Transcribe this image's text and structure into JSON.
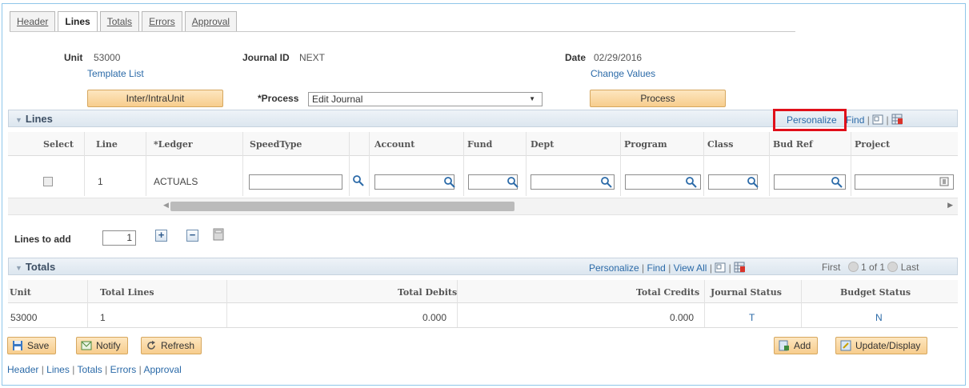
{
  "tabs": [
    {
      "label": "Header",
      "active": false
    },
    {
      "label": "Lines",
      "active": true
    },
    {
      "label": "Totals",
      "active": false
    },
    {
      "label": "Errors",
      "active": false
    },
    {
      "label": "Approval",
      "active": false
    }
  ],
  "header": {
    "unit_label": "Unit",
    "unit_value": "53000",
    "journal_label": "Journal ID",
    "journal_value": "NEXT",
    "date_label": "Date",
    "date_value": "02/29/2016",
    "template_link": "Template List",
    "change_values_link": "Change Values",
    "inter_button": "Inter/IntraUnit",
    "process_label": "*Process",
    "process_value": "Edit Journal",
    "process_button": "Process"
  },
  "lines": {
    "title": "Lines",
    "personalize": "Personalize",
    "find": "Find",
    "columns": [
      "Select",
      "Line",
      "*Ledger",
      "SpeedType",
      "Account",
      "Fund",
      "Dept",
      "Program",
      "Class",
      "Bud Ref",
      "Project"
    ],
    "row": {
      "line": "1",
      "ledger": "ACTUALS"
    },
    "lines_to_add_label": "Lines to add",
    "lines_to_add_value": "1"
  },
  "totals": {
    "title": "Totals",
    "personalize": "Personalize",
    "find": "Find",
    "view_all": "View All",
    "first": "First",
    "page": "1 of 1",
    "last": "Last",
    "columns": [
      "Unit",
      "Total Lines",
      "Total Debits",
      "Total Credits",
      "Journal Status",
      "Budget Status"
    ],
    "row": {
      "unit": "53000",
      "total_lines": "1",
      "total_debits": "0.000",
      "total_credits": "0.000",
      "journal_status": "T",
      "budget_status": "N"
    }
  },
  "footer": {
    "save": "Save",
    "notify": "Notify",
    "refresh": "Refresh",
    "add": "Add",
    "update_display": "Update/Display",
    "links": [
      "Header",
      "Lines",
      "Totals",
      "Errors",
      "Approval"
    ]
  },
  "colors": {
    "highlight": "#e0101a",
    "link": "#2b6aa8",
    "button": "#f7cd8d"
  }
}
